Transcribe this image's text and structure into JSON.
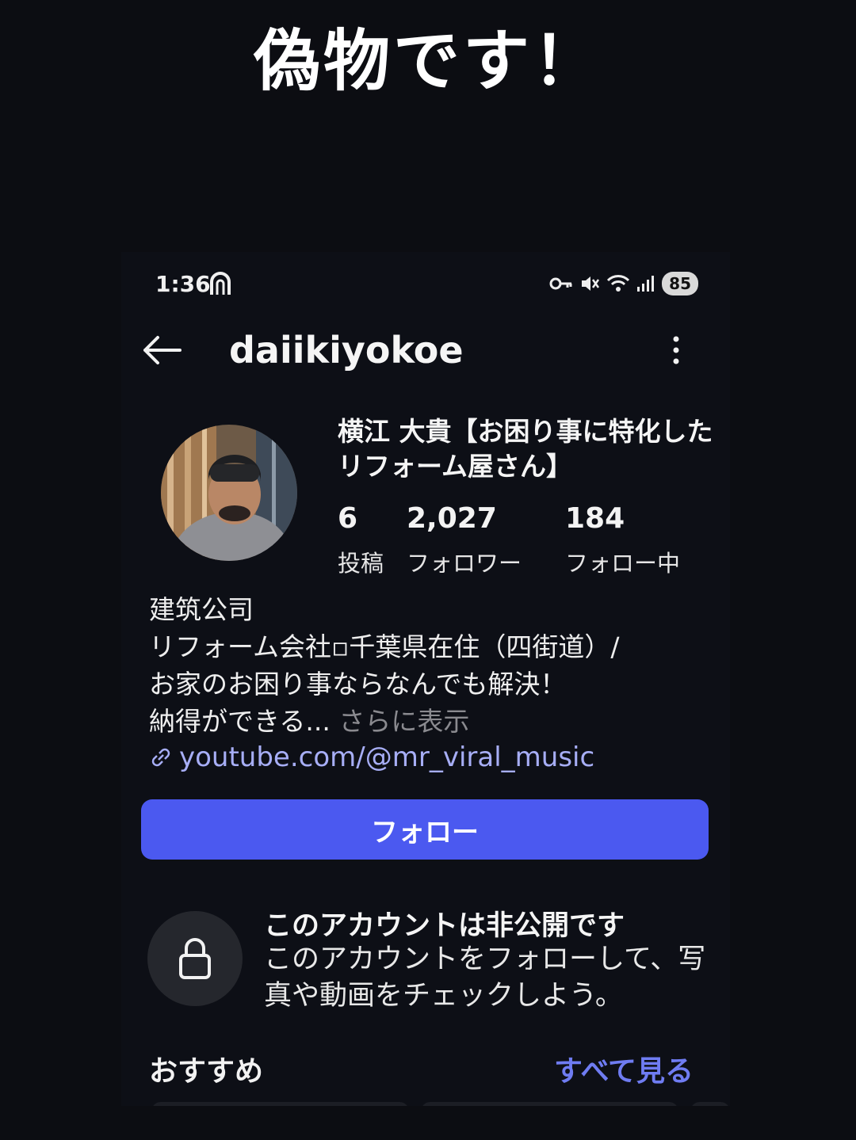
{
  "banner": "偽物です！",
  "status": {
    "time": "1:36",
    "battery": "85"
  },
  "profile": {
    "username": "daiikiyokoe",
    "display_name": "横江 大貴【お困り事に特化したリフォーム屋さん】",
    "stats": [
      {
        "count": "6",
        "label": "投稿"
      },
      {
        "count": "2,027",
        "label": "フォロワー"
      },
      {
        "count": "184",
        "label": "フォロー中"
      }
    ],
    "bio": {
      "line1": "建筑公司",
      "line2": "リフォーム会社▫千葉県在住（四街道）/",
      "line3": "お家のお困り事ならなんでも解決！",
      "line4": "納得ができる...",
      "more": "さらに表示"
    },
    "link": "youtube.com/@mr_viral_music",
    "follow_label": "フォロー"
  },
  "private": {
    "title": "このアカウントは非公開です",
    "description": "このアカウントをフォローして、写真や動画をチェックしよう。"
  },
  "recommendations": {
    "title": "おすすめ",
    "see_all": "すべて見る"
  },
  "icons": [
    "back-arrow-icon",
    "more-vertical-icon",
    "lock-icon",
    "link-icon",
    "threads-icon",
    "key-icon",
    "mute-icon",
    "wifi-icon",
    "signal-icon"
  ],
  "colors": {
    "background": "#0d0f16",
    "accent": "#4b59f0",
    "link": "#a7aef6",
    "see_all": "#6f7cf2"
  }
}
